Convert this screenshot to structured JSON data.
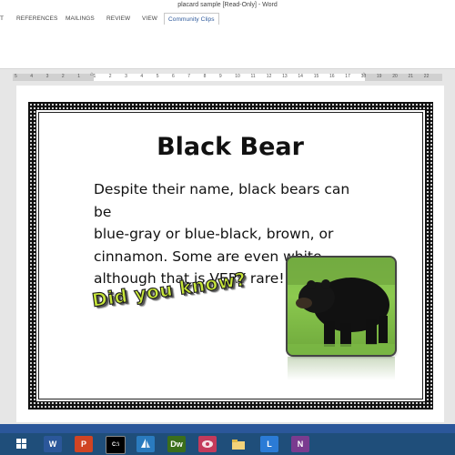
{
  "window": {
    "title": "placard sample [Read-Only] - Word"
  },
  "ribbon": {
    "tabs": [
      {
        "label": "T",
        "active": false
      },
      {
        "label": "REFERENCES",
        "active": false
      },
      {
        "label": "MAILINGS",
        "active": false
      },
      {
        "label": "REVIEW",
        "active": false
      },
      {
        "label": "VIEW",
        "active": false
      },
      {
        "label": "Community Clips",
        "active": true
      }
    ]
  },
  "ruler": {
    "numbers": [
      "5",
      "4",
      "3",
      "2",
      "1",
      "1",
      "2",
      "3",
      "4",
      "5",
      "6",
      "7",
      "8",
      "9",
      "10",
      "11",
      "12",
      "13",
      "14",
      "15",
      "16",
      "17",
      "18",
      "19",
      "20",
      "21",
      "22"
    ]
  },
  "document": {
    "heading": "Black Bear",
    "body_lines": [
      "Despite their name, black bears can be",
      "blue-gray or blue-black, brown, or",
      "cinnamon. Some are even white,",
      "although that is VERY rare!"
    ],
    "word_art": "Did you know?",
    "photo_subject": "black bear on grass"
  },
  "taskbar": {
    "apps": [
      {
        "icon": "windows-icon",
        "color": "#ffffff"
      },
      {
        "icon": "word-icon",
        "label": "W",
        "color": "#2b579a"
      },
      {
        "icon": "powerpoint-icon",
        "label": "P",
        "color": "#d04423"
      },
      {
        "icon": "command-prompt-icon",
        "label": "C:\\",
        "color": "#000000"
      },
      {
        "icon": "sailboat-icon",
        "color": "#2a7bbf"
      },
      {
        "icon": "dreamweaver-icon",
        "label": "Dw",
        "color": "#3b6e1b"
      },
      {
        "icon": "media-icon",
        "color": "#c43a5b"
      },
      {
        "icon": "folder-icon",
        "color": "#e6c35a"
      },
      {
        "icon": "lync-icon",
        "label": "L",
        "color": "#2b7bd6"
      },
      {
        "icon": "onenote-icon",
        "label": "N",
        "color": "#7a3b8f"
      }
    ]
  }
}
